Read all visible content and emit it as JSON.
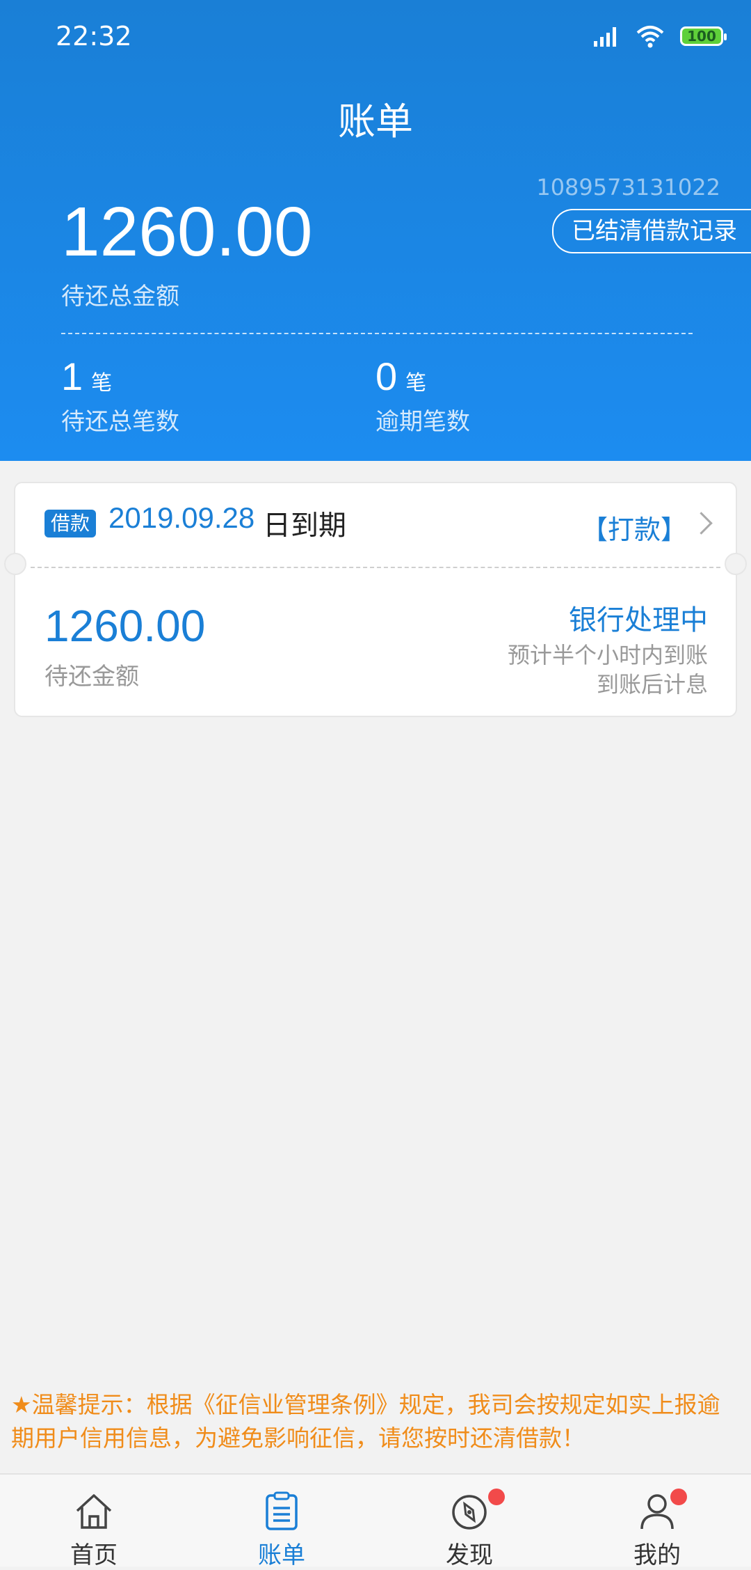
{
  "status_bar": {
    "time": "22:32",
    "battery": "100"
  },
  "header": {
    "title": "账单",
    "account_id": "1089573131022",
    "settled_records_label": "已结清借款记录",
    "total_amount": "1260.00",
    "total_amount_label": "待还总金额",
    "total_count": "1",
    "total_count_unit": "笔",
    "total_count_label": "待还总笔数",
    "overdue_count": "0",
    "overdue_count_unit": "笔",
    "overdue_count_label": "逾期笔数"
  },
  "bill_card": {
    "tag": "借款",
    "due_date": "2019.09.28",
    "due_suffix": "日到期",
    "action": "【打款】",
    "amount": "1260.00",
    "amount_label": "待还金额",
    "status": "银行处理中",
    "status_note_1": "预计半个小时内到账",
    "status_note_2": "到账后计息"
  },
  "notice": {
    "text": "★温馨提示：根据《征信业管理条例》规定，我司会按规定如实上报逾期用户信用信息，为避免影响征信，请您按时还清借款！"
  },
  "tabbar": {
    "items": [
      {
        "label": "首页",
        "icon": "home-icon"
      },
      {
        "label": "账单",
        "icon": "bill-icon",
        "active": true
      },
      {
        "label": "发现",
        "icon": "compass-icon",
        "badge": true
      },
      {
        "label": "我的",
        "icon": "user-icon",
        "badge": true
      }
    ]
  },
  "colors": {
    "primary": "#1a7fd6",
    "warning": "#f08c1a",
    "badge": "#f24a4a"
  }
}
